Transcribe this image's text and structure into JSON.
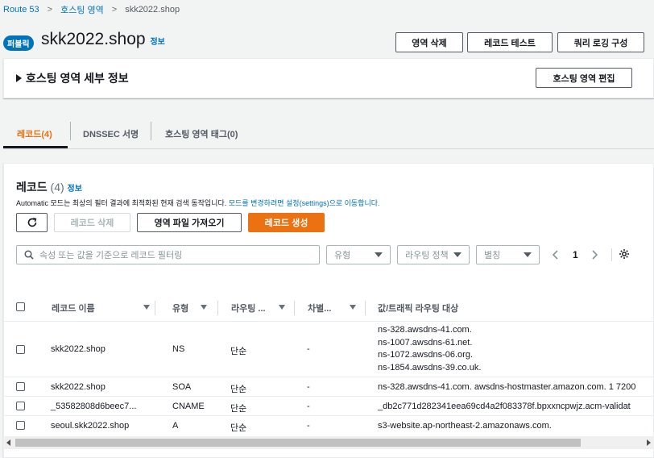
{
  "breadcrumb": {
    "root": "Route 53",
    "middle": "호스팅 영역",
    "current": "skk2022.shop"
  },
  "header": {
    "badge": "퍼블릭",
    "title": "skk2022.shop",
    "info": "정보",
    "buttons": {
      "delete_zone": "영역 삭제",
      "test_record": "레코드 테스트",
      "query_logging": "쿼리 로깅 구성"
    }
  },
  "details": {
    "title": "호스팅 영역 세부 정보",
    "edit_button": "호스팅 영역 편집"
  },
  "tabs": [
    "레코드(4)",
    "DNSSEC 서명",
    "호스팅 영역 태그(0)"
  ],
  "records": {
    "title": "레코드",
    "count": "(4)",
    "info": "정보",
    "desc_prefix": "Automatic 모드는 최상의 필터 결과에 최적화된 현재 검색 동작입니다.",
    "desc_link": "모드를 변경하려면 설정(settings)으로 이동합니다.",
    "delete_button": "레코드 삭제",
    "import_button": "영역 파일 가져오기",
    "create_button": "레코드 생성",
    "search_placeholder": "속성 또는 값을 기준으로 레코드 필터링",
    "filter_type": "유형",
    "filter_routing": "라우팅 정책",
    "filter_alias": "별칭",
    "page": "1"
  },
  "table": {
    "columns": [
      "레코드 이름",
      "유형",
      "라우팅 ...",
      "차별...",
      "값/트래픽 라우팅 대상"
    ],
    "rows": [
      {
        "name": "skk2022.shop",
        "type": "NS",
        "routing": "단순",
        "diff": "-",
        "values": [
          "ns-328.awsdns-41.com.",
          "ns-1007.awsdns-61.net.",
          "ns-1072.awsdns-06.org.",
          "ns-1854.awsdns-39.co.uk."
        ]
      },
      {
        "name": "skk2022.shop",
        "type": "SOA",
        "routing": "단순",
        "diff": "-",
        "values": [
          "ns-328.awsdns-41.com. awsdns-hostmaster.amazon.com. 1 7200"
        ]
      },
      {
        "name": "_53582808d6beec7...",
        "type": "CNAME",
        "routing": "단순",
        "diff": "-",
        "values": [
          "_db2c771d282341eea69cd4a2f083378f.bpxxncpwjz.acm-validat"
        ]
      },
      {
        "name": "seoul.skk2022.shop",
        "type": "A",
        "routing": "단순",
        "diff": "-",
        "values": [
          "s3-website.ap-northeast-2.amazonaws.com."
        ]
      }
    ]
  },
  "colors": {
    "accent": "#ec7211",
    "link": "#0073bb",
    "badge": "#0073bb"
  }
}
